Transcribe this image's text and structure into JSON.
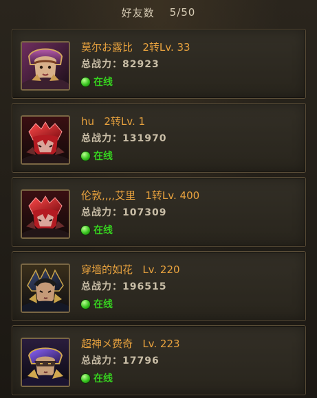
{
  "header": {
    "title": "好友数",
    "count": "5/50"
  },
  "friends": [
    {
      "name": "莫尔お露比",
      "rank": "2转Lv. 33",
      "power_label": "总战力：",
      "power_value": "82923",
      "status": "在线",
      "avatar_icon": "female-warrior-portrait-icon"
    },
    {
      "name": "hu",
      "rank": "2转Lv. 1",
      "power_label": "总战力：",
      "power_value": "131970",
      "status": "在线",
      "avatar_icon": "red-dragon-helmet-portrait-icon"
    },
    {
      "name": "伦敦,,,,艾里",
      "rank": "1转Lv. 400",
      "power_label": "总战力：",
      "power_value": "107309",
      "status": "在线",
      "avatar_icon": "red-dragon-helmet-portrait-icon"
    },
    {
      "name": "穿墙的如花",
      "rank": "Lv. 220",
      "power_label": "总战力：",
      "power_value": "196515",
      "status": "在线",
      "avatar_icon": "dark-armored-warrior-portrait-icon"
    },
    {
      "name": "超神メ费奇",
      "rank": "Lv. 223",
      "power_label": "总战力：",
      "power_value": "17796",
      "status": "在线",
      "avatar_icon": "purple-masked-warrior-portrait-icon"
    }
  ],
  "colors": {
    "name": "#e8a23e",
    "online": "#36d11f"
  }
}
